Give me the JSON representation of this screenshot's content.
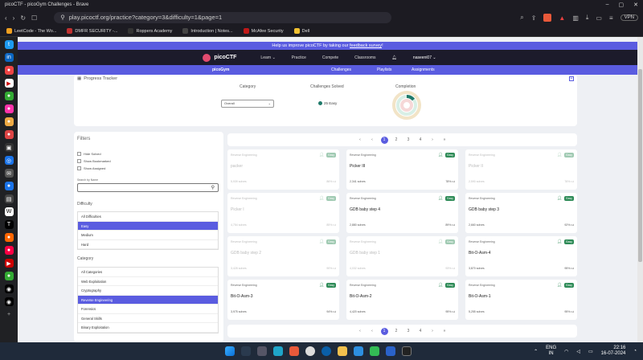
{
  "browser": {
    "window_title": "picoCTF - picoGym Challenges - Brave",
    "url": "play.picoctf.org/practice?category=3&difficulty=1&page=1",
    "vpn_label": "VPN",
    "bookmarks": [
      {
        "label": "LeetCode - The Wo...",
        "color": "#f0a020"
      },
      {
        "label": "DMFR SECURITY -...",
        "color": "#c03030"
      },
      {
        "label": "Roppers Academy",
        "color": "#333333"
      },
      {
        "label": "Introduction | Notes...",
        "color": "#444444"
      },
      {
        "label": "McAfee Security",
        "color": "#c01818"
      },
      {
        "label": "Dell",
        "color": "#f0c030"
      }
    ]
  },
  "site": {
    "banner_prefix": "Help us improve picoCTF by taking our ",
    "banner_link": "feedback survey",
    "banner_suffix": "!",
    "logo": "picoCTF",
    "nav": [
      "Learn ⌄",
      "Practice",
      "Compete",
      "Classrooms"
    ],
    "user": "naseeni07 ⌄",
    "subnav_brand": "picoGym",
    "subnav": [
      "Challenges",
      "Playlists",
      "Assignments"
    ]
  },
  "tracker": {
    "title": "Progress Tracker",
    "category_label": "Category",
    "category_value": "Overall",
    "solved_label": "Challenges Solved",
    "solved_value": "25 Easy",
    "completion_label": "Completion"
  },
  "filters": {
    "title": "Filters",
    "checkboxes": [
      "Hide Solved",
      "Show Bookmarked",
      "Show Assigned"
    ],
    "search_label": "Search by Name",
    "difficulty_label": "Difficulty",
    "difficulties": [
      "All Difficulties",
      "Easy",
      "Medium",
      "Hard"
    ],
    "difficulty_selected": 1,
    "category_label": "Category",
    "categories": [
      "All Categories",
      "Web Exploitation",
      "Cryptography",
      "Reverse Engineering",
      "Forensics",
      "General Skills",
      "Binary Exploitation"
    ],
    "category_selected": 3
  },
  "pager": [
    "‹",
    "‹",
    "1",
    "2",
    "3",
    "4",
    "›",
    "»"
  ],
  "pager_active": 2,
  "cards": [
    {
      "category": "Reverse Engineering",
      "difficulty": "Easy",
      "name": "packer",
      "solves": "5,939 solves",
      "rate": "86%",
      "dim": true
    },
    {
      "category": "Reverse Engineering",
      "difficulty": "Easy",
      "name": "Picker III",
      "solves": "2,341 solves",
      "rate": "78%",
      "dim": false
    },
    {
      "category": "Reverse Engineering",
      "difficulty": "Easy",
      "name": "Picker II",
      "solves": "2,590 solves",
      "rate": "76%",
      "dim": true
    },
    {
      "category": "Reverse Engineering",
      "difficulty": "Easy",
      "name": "Picker I",
      "solves": "4,754 solves",
      "rate": "85%",
      "dim": true
    },
    {
      "category": "Reverse Engineering",
      "difficulty": "Easy",
      "name": "GDB baby step 4",
      "solves": "2,880 solves",
      "rate": "89%",
      "dim": false
    },
    {
      "category": "Reverse Engineering",
      "difficulty": "Easy",
      "name": "GDB baby step 3",
      "solves": "2,660 solves",
      "rate": "92%",
      "dim": false
    },
    {
      "category": "Reverse Engineering",
      "difficulty": "Easy",
      "name": "GDB baby step 2",
      "solves": "3,428 solves",
      "rate": "90%",
      "dim": true
    },
    {
      "category": "Reverse Engineering",
      "difficulty": "Easy",
      "name": "GDB baby step 1",
      "solves": "4,032 solves",
      "rate": "93%",
      "dim": true
    },
    {
      "category": "Reverse Engineering",
      "difficulty": "Easy",
      "name": "Bit-O-Asm-4",
      "solves": "3,870 solves",
      "rate": "95%",
      "dim": false
    },
    {
      "category": "Reverse Engineering",
      "difficulty": "Easy",
      "name": "Bit-O-Asm-3",
      "solves": "3,975 solves",
      "rate": "94%",
      "dim": false
    },
    {
      "category": "Reverse Engineering",
      "difficulty": "Easy",
      "name": "Bit-O-Asm-2",
      "solves": "4,420 solves",
      "rate": "95%",
      "dim": false
    },
    {
      "category": "Reverse Engineering",
      "difficulty": "Easy",
      "name": "Bit-O-Asm-1",
      "solves": "5,255 solves",
      "rate": "95%",
      "dim": false
    }
  ],
  "taskbar": {
    "lang": "ENG",
    "region": "IN",
    "time": "22:16",
    "date": "16-07-2024"
  }
}
